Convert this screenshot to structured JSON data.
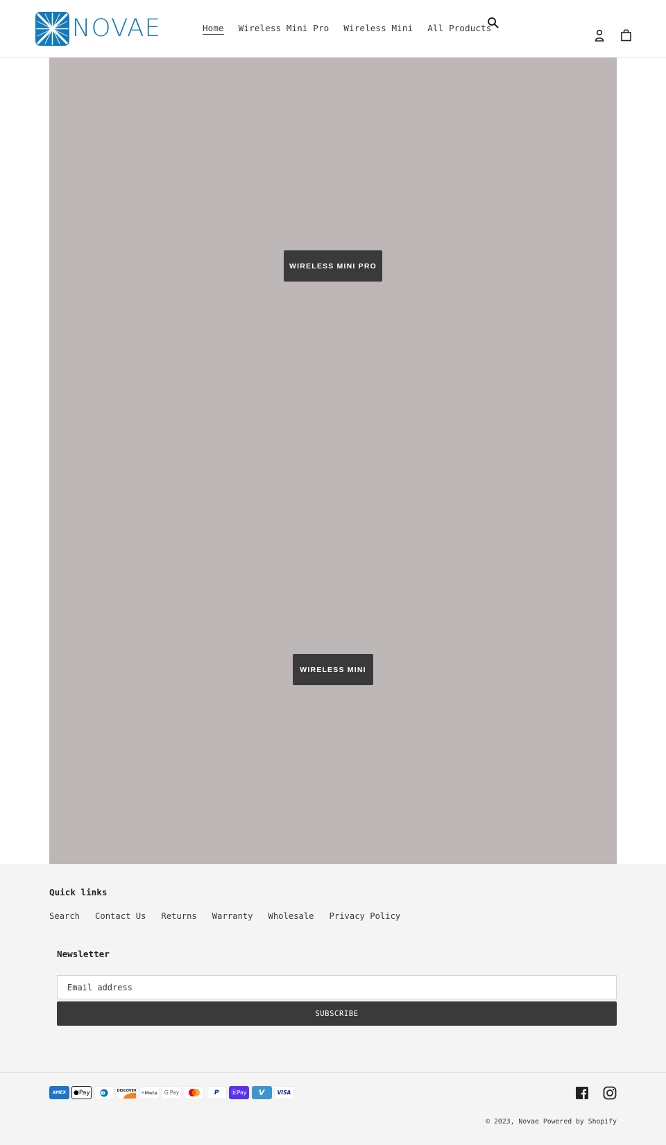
{
  "header": {
    "logo_text": "NOVAE",
    "brand_color": "#1279bc",
    "nav": [
      {
        "label": "Home",
        "active": true
      },
      {
        "label": "Wireless Mini Pro",
        "active": false
      },
      {
        "label": "Wireless Mini",
        "active": false
      },
      {
        "label": "All Products",
        "active": false
      }
    ],
    "icons": {
      "search": "search-icon",
      "account": "user-icon",
      "cart": "bag-icon"
    }
  },
  "hero": {
    "background_color": "#bdb7b7",
    "slides": [
      {
        "button_label": "WIRELESS MINI PRO"
      },
      {
        "button_label": "WIRELESS MINI"
      }
    ]
  },
  "footer": {
    "quick_links_title": "Quick links",
    "quick_links": [
      "Search",
      "Contact Us",
      "Returns",
      "Warranty",
      "Wholesale",
      "Privacy Policy"
    ],
    "newsletter_title": "Newsletter",
    "email_placeholder": "Email address",
    "subscribe_label": "SUBSCRIBE",
    "payment_methods": [
      {
        "name": "American Express",
        "text": "AMEX"
      },
      {
        "name": "Apple Pay",
        "text": "Pay"
      },
      {
        "name": "Diners Club",
        "text": ""
      },
      {
        "name": "Discover",
        "text": "DISCOVER"
      },
      {
        "name": "Meta Pay",
        "text": "Meta"
      },
      {
        "name": "Google Pay",
        "text": "G Pay"
      },
      {
        "name": "Mastercard",
        "text": ""
      },
      {
        "name": "PayPal",
        "text": "P"
      },
      {
        "name": "Shop Pay",
        "text": "Pay"
      },
      {
        "name": "Venmo",
        "text": "V"
      },
      {
        "name": "Visa",
        "text": "VISA"
      }
    ],
    "social": [
      "facebook-icon",
      "instagram-icon"
    ],
    "copyright": "© 2023, Novae",
    "powered_by": "Powered by Shopify"
  }
}
